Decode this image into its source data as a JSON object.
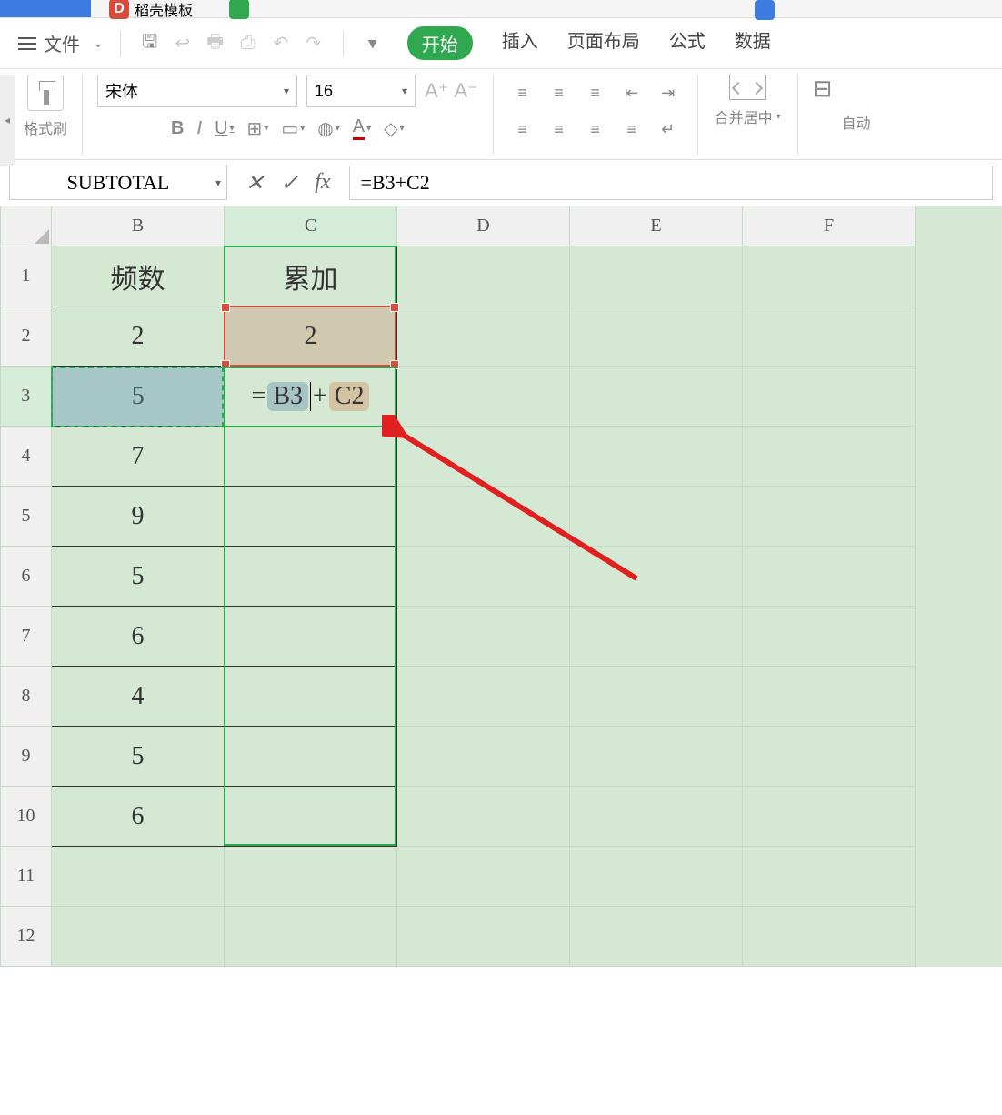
{
  "tabs": {
    "d_label": "D",
    "d_text": "稻壳模板"
  },
  "menu": {
    "file": "文件",
    "nav": [
      "开始",
      "插入",
      "页面布局",
      "公式",
      "数据"
    ]
  },
  "ribbon": {
    "brush": "格式刷",
    "font_name": "宋体",
    "font_size": "16",
    "merge": "合并居中",
    "auto": "自动"
  },
  "formula_bar": {
    "name_box": "SUBTOTAL",
    "cancel": "✕",
    "confirm": "✓",
    "fx": "fx",
    "formula": "=B3+C2"
  },
  "sheet": {
    "columns": [
      "B",
      "C",
      "D",
      "E",
      "F"
    ],
    "rows": [
      "1",
      "2",
      "3",
      "4",
      "5",
      "6",
      "7",
      "8",
      "9",
      "10",
      "11",
      "12"
    ],
    "headers": {
      "B1": "频数",
      "C1": "累加"
    },
    "data_B": [
      "2",
      "5",
      "7",
      "9",
      "5",
      "6",
      "4",
      "5",
      "6"
    ],
    "data_C": [
      "2"
    ],
    "editing_cell": {
      "prefix": "=",
      "ref1": "B3",
      "op": "+",
      "ref2": "C2"
    }
  }
}
